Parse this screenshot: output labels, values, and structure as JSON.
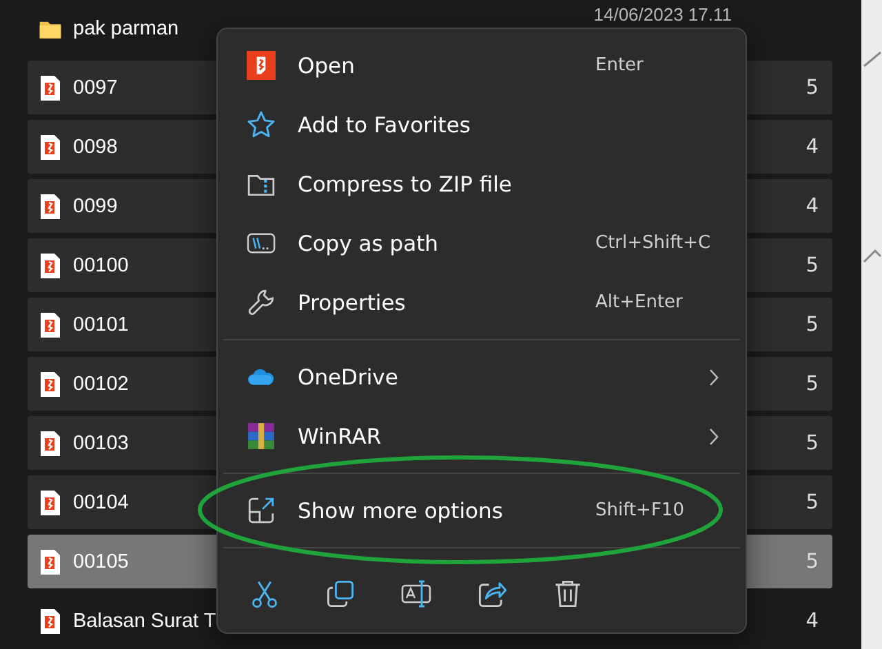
{
  "files": [
    {
      "name": "pak parman",
      "kind": "folder",
      "date": "14/06/2023 17.11",
      "selected": false,
      "focused": false
    },
    {
      "name": "0097",
      "kind": "document",
      "date": "5",
      "selected": true,
      "focused": false
    },
    {
      "name": "0098",
      "kind": "document",
      "date": "4",
      "selected": true,
      "focused": false
    },
    {
      "name": "0099",
      "kind": "document",
      "date": "4",
      "selected": true,
      "focused": false
    },
    {
      "name": "00100",
      "kind": "document",
      "date": "5",
      "selected": true,
      "focused": false
    },
    {
      "name": "00101",
      "kind": "document",
      "date": "5",
      "selected": true,
      "focused": false
    },
    {
      "name": "00102",
      "kind": "document",
      "date": "5",
      "selected": true,
      "focused": false
    },
    {
      "name": "00103",
      "kind": "document",
      "date": "5",
      "selected": true,
      "focused": false
    },
    {
      "name": "00104",
      "kind": "document",
      "date": "5",
      "selected": true,
      "focused": false
    },
    {
      "name": "00105",
      "kind": "document",
      "date": "5",
      "selected": true,
      "focused": true
    },
    {
      "name": "Balasan Surat T",
      "kind": "document",
      "date": "4",
      "selected": false,
      "focused": false
    }
  ],
  "context_menu": {
    "sections": [
      [
        {
          "label": "Open",
          "shortcut": "Enter",
          "submenu": false
        },
        {
          "label": "Add to Favorites",
          "submenu": false
        },
        {
          "label": "Compress to ZIP file",
          "submenu": false
        },
        {
          "label": "Copy as path",
          "shortcut": "Ctrl+Shift+C",
          "submenu": false
        },
        {
          "label": "Properties",
          "shortcut": "Alt+Enter",
          "submenu": false
        }
      ],
      [
        {
          "label": "OneDrive",
          "submenu": true
        },
        {
          "label": "WinRAR",
          "submenu": true
        }
      ],
      [
        {
          "label": "Show more options",
          "shortcut": "Shift+F10",
          "submenu": false,
          "circled": true
        }
      ]
    ]
  }
}
